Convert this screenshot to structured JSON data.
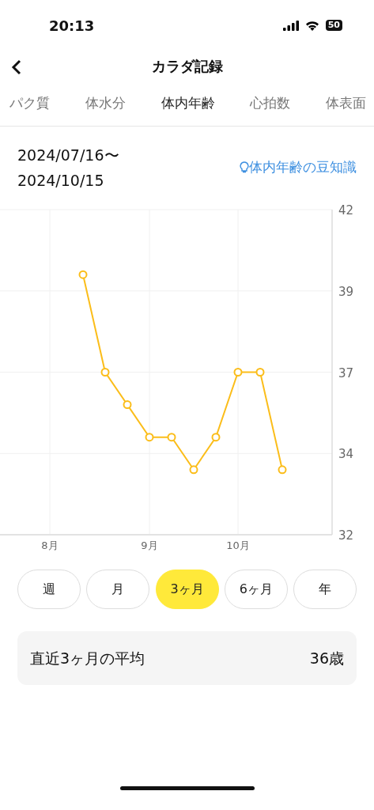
{
  "status_bar": {
    "time": "20:13",
    "battery": "50"
  },
  "header": {
    "title": "カラダ記録"
  },
  "tabs": [
    {
      "label": "パク質",
      "selected": false
    },
    {
      "label": "体水分",
      "selected": false
    },
    {
      "label": "体内年齢",
      "selected": true
    },
    {
      "label": "心拍数",
      "selected": false
    },
    {
      "label": "体表面",
      "selected": false
    }
  ],
  "date_range": [
    "2024/07/16〜",
    "2024/10/15"
  ],
  "tip_link": "体内年齢の豆知識",
  "chart_data": {
    "type": "line",
    "categories": [
      null,
      null,
      null,
      null,
      "8月",
      null,
      null,
      null,
      null,
      null,
      null,
      null,
      null,
      "9月",
      null,
      null,
      null,
      null,
      null,
      null,
      null,
      "10月",
      null,
      null,
      null,
      null,
      null,
      null,
      null,
      null
    ],
    "grid": true,
    "series": [
      {
        "color": "#fbbd1a",
        "marker": "circle",
        "values": [
          null,
          null,
          null,
          null,
          null,
          null,
          null,
          40,
          null,
          37,
          null,
          36,
          null,
          35,
          null,
          35,
          null,
          34,
          null,
          35,
          null,
          37,
          null,
          37,
          null,
          34,
          null,
          null,
          null,
          null
        ]
      }
    ],
    "ylim": [
      32,
      42
    ],
    "yticks": [
      {
        "value": 42,
        "label": "42"
      },
      {
        "value": 39.5,
        "label": "39"
      },
      {
        "value": 37,
        "label": "37"
      },
      {
        "value": 34.5,
        "label": "34"
      },
      {
        "value": 32,
        "label": "32"
      }
    ]
  },
  "periods": [
    {
      "label": "週",
      "selected": false
    },
    {
      "label": "月",
      "selected": false
    },
    {
      "label": "3ヶ月",
      "selected": true
    },
    {
      "label": "6ヶ月",
      "selected": false
    },
    {
      "label": "年",
      "selected": false
    }
  ],
  "summary": {
    "label": "直近3ヶ月の平均",
    "value": "36歳"
  }
}
